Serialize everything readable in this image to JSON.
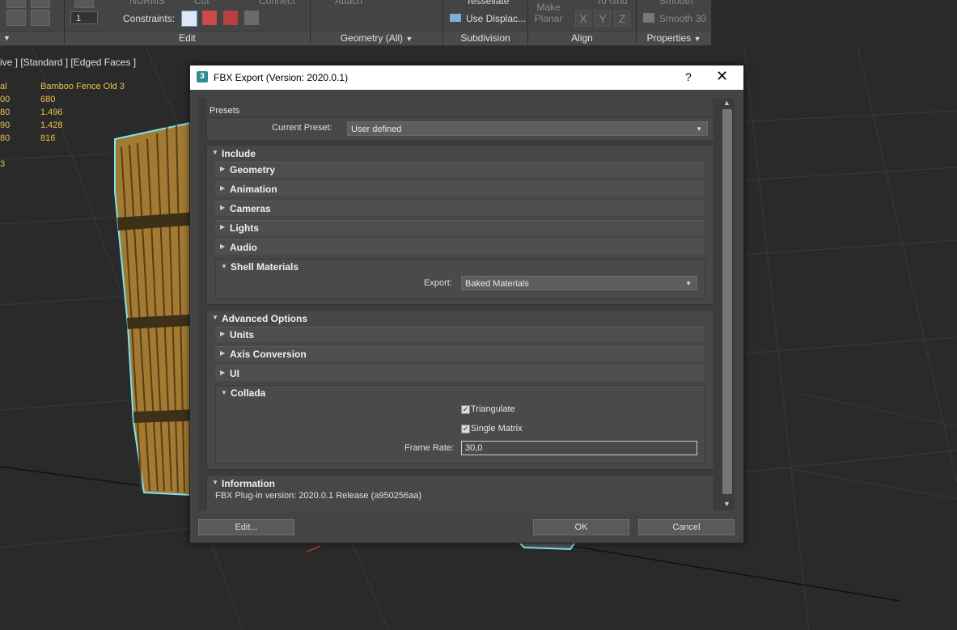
{
  "ribbon": {
    "panels": [
      {
        "label": "",
        "dropdown": true
      },
      {
        "label": "Edit"
      },
      {
        "label": "Geometry (All)",
        "dropdown": true
      },
      {
        "label": "Subdivision"
      },
      {
        "label": "Align"
      },
      {
        "label": "Properties",
        "dropdown": true
      }
    ],
    "spinner_value": "1",
    "constraints_label": "Constraints:",
    "notwts_label": "NURMS",
    "cut_label": "Cut",
    "connect_label": "Connect",
    "attach_label": "Attach",
    "tessellate_label": "Tessellate",
    "use_displace_label": "Use Displac...",
    "make_planar_label": "Make Planar",
    "to_grid_label": "To Grid",
    "xyz": [
      "X",
      "Y",
      "Z"
    ],
    "smooth_label": "Smooth",
    "smooth30_label": "Smooth 30"
  },
  "viewport": {
    "label": "ive ] [Standard ] [Edged Faces ]",
    "stats_left": [
      "al",
      "00",
      "80",
      "90",
      "80",
      "",
      "3"
    ],
    "stats_right": [
      "Bamboo Fence Old 3",
      "680",
      "1.496",
      "1.428",
      "816"
    ]
  },
  "dialog": {
    "icon_text": "3",
    "title": "FBX Export (Version: 2020.0.1)",
    "help": "?",
    "close": "✕",
    "presets": {
      "title": "Presets",
      "current_label": "Current Preset:",
      "current_value": "User defined"
    },
    "include": {
      "title": "Include",
      "items": [
        "Geometry",
        "Animation",
        "Cameras",
        "Lights",
        "Audio"
      ],
      "shell": {
        "title": "Shell Materials",
        "export_label": "Export:",
        "export_value": "Baked Materials"
      }
    },
    "advanced": {
      "title": "Advanced Options",
      "items": [
        "Units",
        "Axis Conversion",
        "UI"
      ],
      "collada": {
        "title": "Collada",
        "triangulate": "Triangulate",
        "triangulate_checked": true,
        "single_matrix": "Single Matrix",
        "single_matrix_checked": true,
        "frame_rate_label": "Frame Rate:",
        "frame_rate_value": "30,0"
      }
    },
    "information": {
      "title": "Information",
      "text": "FBX Plug-in version: 2020.0.1 Release (a950256aa)"
    },
    "buttons": {
      "edit": "Edit...",
      "ok": "OK",
      "cancel": "Cancel"
    }
  }
}
